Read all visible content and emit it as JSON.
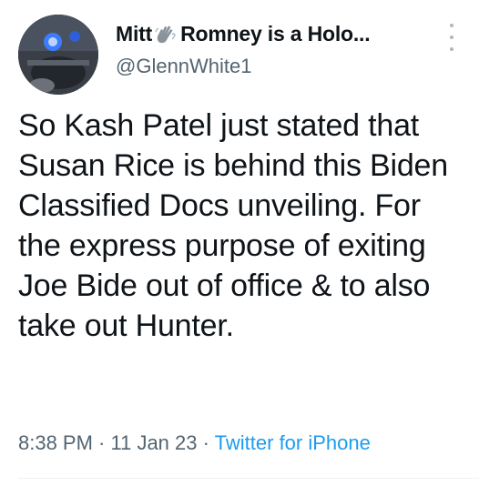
{
  "author": {
    "name_part1": "Mitt",
    "name_icon": "hand-wave-icon",
    "name_part2": "Romney is a Holo...",
    "handle": "@GlennWhite1",
    "avatar": "avatar-photo"
  },
  "tweet": {
    "text": "So Kash Patel just stated that Susan Rice is behind this Biden Classified Docs unveiling. For the express purpose of exiting Joe Bide out of office & to also take out Hunter.",
    "time": "8:38 PM",
    "separator": " · ",
    "date": "11 Jan 23",
    "source": "Twitter for iPhone"
  },
  "colors": {
    "text": "#0f1419",
    "secondary": "#536471",
    "link": "#1d9bf0",
    "divider": "#eff3f4"
  },
  "more_menu_icon": "vertical-ellipsis-icon"
}
